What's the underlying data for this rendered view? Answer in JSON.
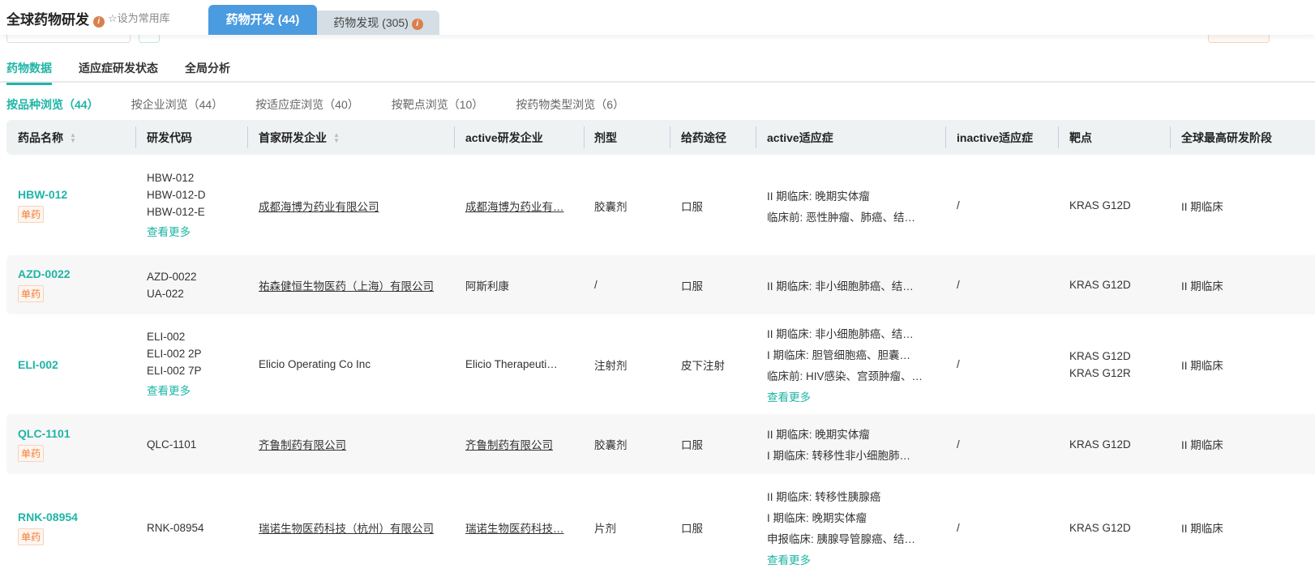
{
  "header": {
    "title": "全球药物研发",
    "favorite": "设为常用库",
    "tabs": [
      {
        "label": "药物开发 (44)"
      },
      {
        "label": "药物发现 (305)"
      }
    ]
  },
  "nav": [
    "药物数据",
    "适应症研发状态",
    "全局分析"
  ],
  "browse": [
    "按品种浏览（44）",
    "按企业浏览（44）",
    "按适应症浏览（40）",
    "按靶点浏览（10）",
    "按药物类型浏览（6）"
  ],
  "columns": [
    "药品名称",
    "研发代码",
    "首家研发企业",
    "active研发企业",
    "剂型",
    "给药途径",
    "active适应症",
    "inactive适应症",
    "靶点",
    "全球最高研发阶段"
  ],
  "more_label": "查看更多",
  "rows": [
    {
      "name": "HBW-012",
      "badge": "单药",
      "codes": [
        "HBW-012",
        "HBW-012-D",
        "HBW-012-E"
      ],
      "codes_more": true,
      "first": "成都海博为药业有限公司",
      "active": "成都海博为药业有…",
      "form": "胶囊剂",
      "route": "口服",
      "ind": [
        "II 期临床: 晚期实体瘤",
        "临床前: 恶性肿瘤、肺癌、结…"
      ],
      "ind_more": false,
      "inactive": "/",
      "targets": [
        "KRAS G12D"
      ],
      "phase": "II 期临床"
    },
    {
      "name": "AZD-0022",
      "badge": "单药",
      "codes": [
        "AZD-0022",
        "UA-022"
      ],
      "codes_more": false,
      "first": "祐森健恒生物医药（上海）有限公司",
      "active": "阿斯利康",
      "form": "/",
      "route": "口服",
      "ind": [
        "II 期临床: 非小细胞肺癌、结…"
      ],
      "ind_more": false,
      "inactive": "/",
      "targets": [
        "KRAS G12D"
      ],
      "phase": "II 期临床"
    },
    {
      "name": "ELI-002",
      "badge": "",
      "codes": [
        "ELI-002",
        "ELI-002 2P",
        "ELI-002 7P"
      ],
      "codes_more": true,
      "first": "Elicio Operating Co Inc",
      "active": "Elicio Therapeuti…",
      "form": "注射剂",
      "route": "皮下注射",
      "ind": [
        "II 期临床: 非小细胞肺癌、结…",
        "I 期临床: 胆管细胞癌、胆囊…",
        "临床前: HIV感染、宫颈肿瘤、…"
      ],
      "ind_more": true,
      "inactive": "/",
      "targets": [
        "KRAS G12D",
        "KRAS G12R"
      ],
      "phase": "II 期临床"
    },
    {
      "name": "QLC-1101",
      "badge": "单药",
      "codes": [
        "QLC-1101"
      ],
      "codes_more": false,
      "first": "齐鲁制药有限公司",
      "active": "齐鲁制药有限公司",
      "form": "胶囊剂",
      "route": "口服",
      "ind": [
        "II 期临床: 晚期实体瘤",
        "I 期临床: 转移性非小细胞肺…"
      ],
      "ind_more": false,
      "inactive": "/",
      "targets": [
        "KRAS G12D"
      ],
      "phase": "II 期临床"
    },
    {
      "name": "RNK-08954",
      "badge": "单药",
      "codes": [
        "RNK-08954"
      ],
      "codes_more": false,
      "first": "瑞诺生物医药科技（杭州）有限公司",
      "active": "瑞诺生物医药科技…",
      "form": "片剂",
      "route": "口服",
      "ind": [
        "II 期临床: 转移性胰腺癌",
        "I 期临床: 晚期实体瘤",
        "申报临床: 胰腺导管腺癌、结…"
      ],
      "ind_more": true,
      "inactive": "/",
      "targets": [
        "KRAS G12D"
      ],
      "phase": "II 期临床"
    }
  ]
}
